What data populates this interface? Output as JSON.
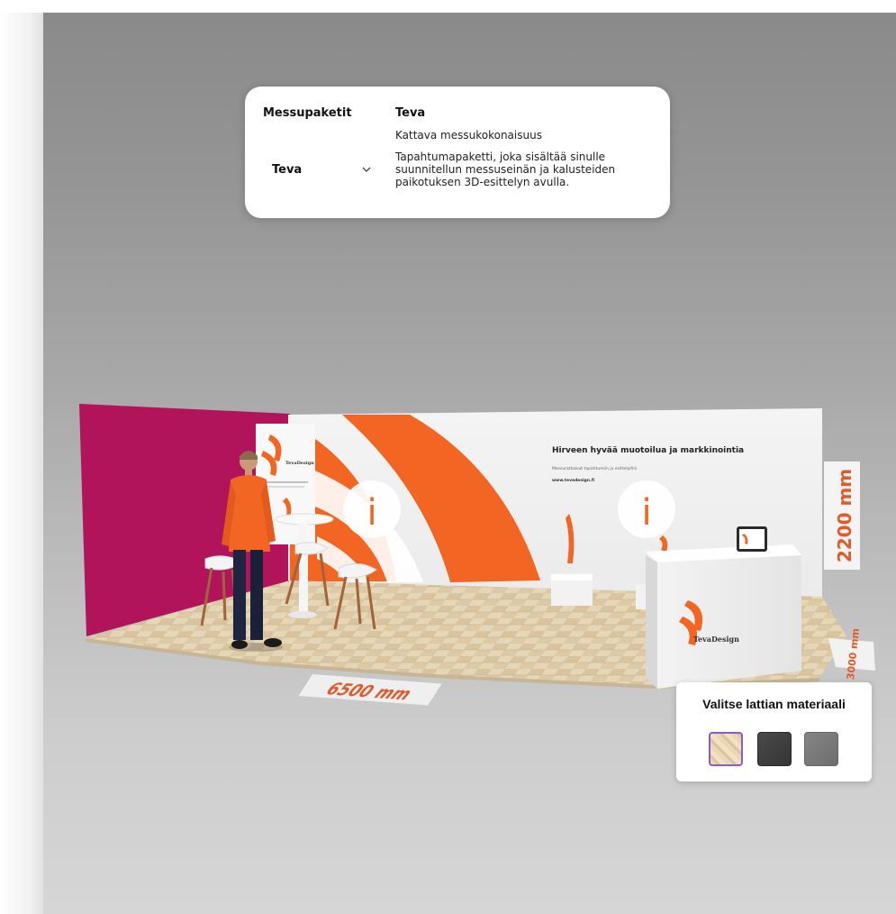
{
  "package_card": {
    "heading": "Messupaketit",
    "selected": "Teva",
    "name": "Teva",
    "subtitle": "Kattava messukokonaisuus",
    "description": "Tapahtumapaketti, joka sisältää sinulle suunnitellun messuseinän ja kalusteiden paikotuksen 3D-esittelyn avulla."
  },
  "booth": {
    "wall_heading": "Hirveen hyvää muotoilua ja markkinointia",
    "wall_subtext": "Messuratkaisut tapahtumiin ja esittelyihin",
    "wall_url": "www.tevadesign.fi",
    "rollup_brand": "TevaDesign",
    "counter_brand": "TevaDesign",
    "info_glyph": "i",
    "width_label": "6500 mm",
    "height_label": "2200 mm",
    "depth_label": "3000 mm"
  },
  "floor_material": {
    "title": "Valitse lattian materiaali",
    "options": [
      {
        "name": "wood",
        "color": "#e5d1ad",
        "selected": true
      },
      {
        "name": "dark",
        "color": "#404040",
        "selected": false
      },
      {
        "name": "grey",
        "color": "#7a7a7a",
        "selected": false
      }
    ]
  },
  "colors": {
    "accent_orange": "#f26522",
    "magenta_wall": "#b1145a",
    "label_orange": "#e35a2a",
    "selection_purple": "#8a5cc9"
  }
}
